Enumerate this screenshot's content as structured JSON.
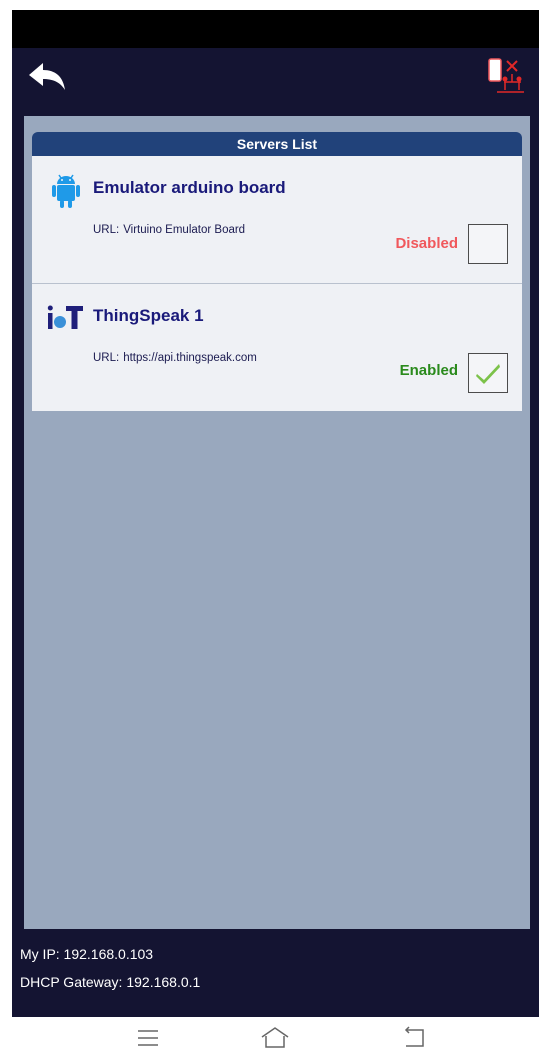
{
  "toolbar": {
    "back_icon": "back-arrow-icon",
    "connection_icon": "disconnected-network-icon"
  },
  "server_list": {
    "title": "Servers List",
    "servers": [
      {
        "name": "Emulator arduino board",
        "url_label": "URL:",
        "url": "Virtuino Emulator Board",
        "status": "Disabled",
        "status_color": "#f0585c",
        "enabled": false,
        "icon": "android-icon"
      },
      {
        "name": "ThingSpeak 1",
        "url_label": "URL:",
        "url": "https://api.thingspeak.com",
        "status": "Enabled",
        "status_color": "#2a8a1c",
        "enabled": true,
        "icon": "iot-icon"
      }
    ]
  },
  "network": {
    "ip": "My IP: 192.168.0.103",
    "gateway": "DHCP Gateway: 192.168.0.1"
  },
  "nav_bar": {
    "icons": [
      "menu-icon",
      "home-icon",
      "back-icon"
    ]
  },
  "colors": {
    "background": "#141432",
    "content_bg": "#99a8be",
    "header_bg": "#21427a",
    "card_bg": "#eff1f5"
  }
}
